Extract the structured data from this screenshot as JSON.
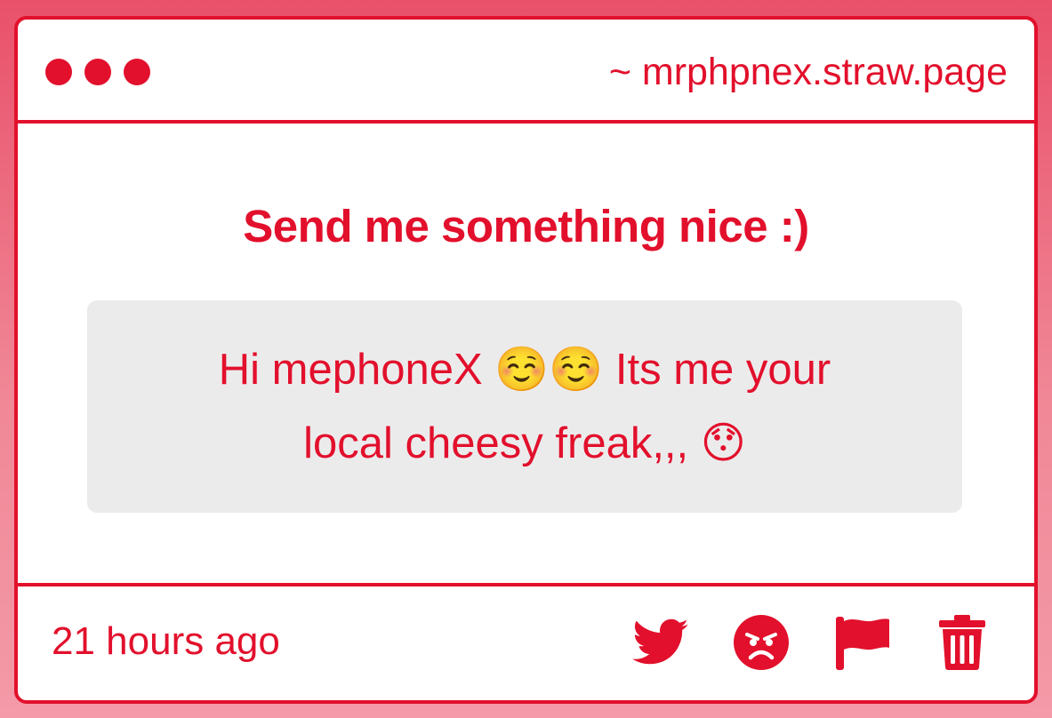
{
  "window": {
    "url": "~ mrphpnex.straw.page"
  },
  "prompt": {
    "heading": "Send me something nice :)"
  },
  "message": {
    "line1": "Hi mephoneX ☺️☺️ Its me your",
    "line2": "local cheesy freak,,, 😯"
  },
  "footer": {
    "timestamp": "21 hours ago",
    "actions": [
      "twitter-icon",
      "angry-face-icon",
      "flag-icon",
      "trash-icon"
    ]
  },
  "colors": {
    "accent": "#e2102c",
    "message_bg": "#ecebec",
    "background_top": "#e9516a",
    "background_bottom": "#f49aa8"
  }
}
